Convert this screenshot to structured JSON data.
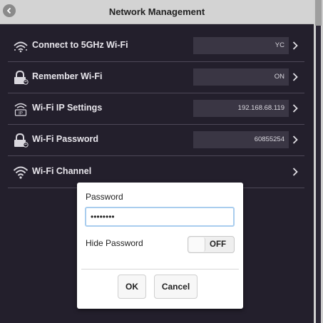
{
  "header": {
    "title": "Network Management",
    "back_icon": "back-arrow-icon"
  },
  "rows": [
    {
      "icon": "wifi-5ghz-icon",
      "label": "Connect to 5GHz Wi-Fi",
      "value": "YC"
    },
    {
      "icon": "wifi-lock-icon",
      "label": "Remember Wi-Fi",
      "value": "ON"
    },
    {
      "icon": "wifi-ip-icon",
      "label": "Wi-Fi IP Settings",
      "value": "192.168.68.119"
    },
    {
      "icon": "wifi-lock-icon",
      "label": "Wi-Fi Password",
      "value": "60855254"
    },
    {
      "icon": "wifi-icon",
      "label": "Wi-Fi Channel",
      "value": ""
    }
  ],
  "dialog": {
    "password_label": "Password",
    "password_value": "••••••••",
    "hide_password_label": "Hide Password",
    "toggle_state": "OFF",
    "ok_label": "OK",
    "cancel_label": "Cancel"
  },
  "colors": {
    "background": "#231f2c",
    "value_box": "#3a3644",
    "input_focus": "#a9cdee"
  }
}
